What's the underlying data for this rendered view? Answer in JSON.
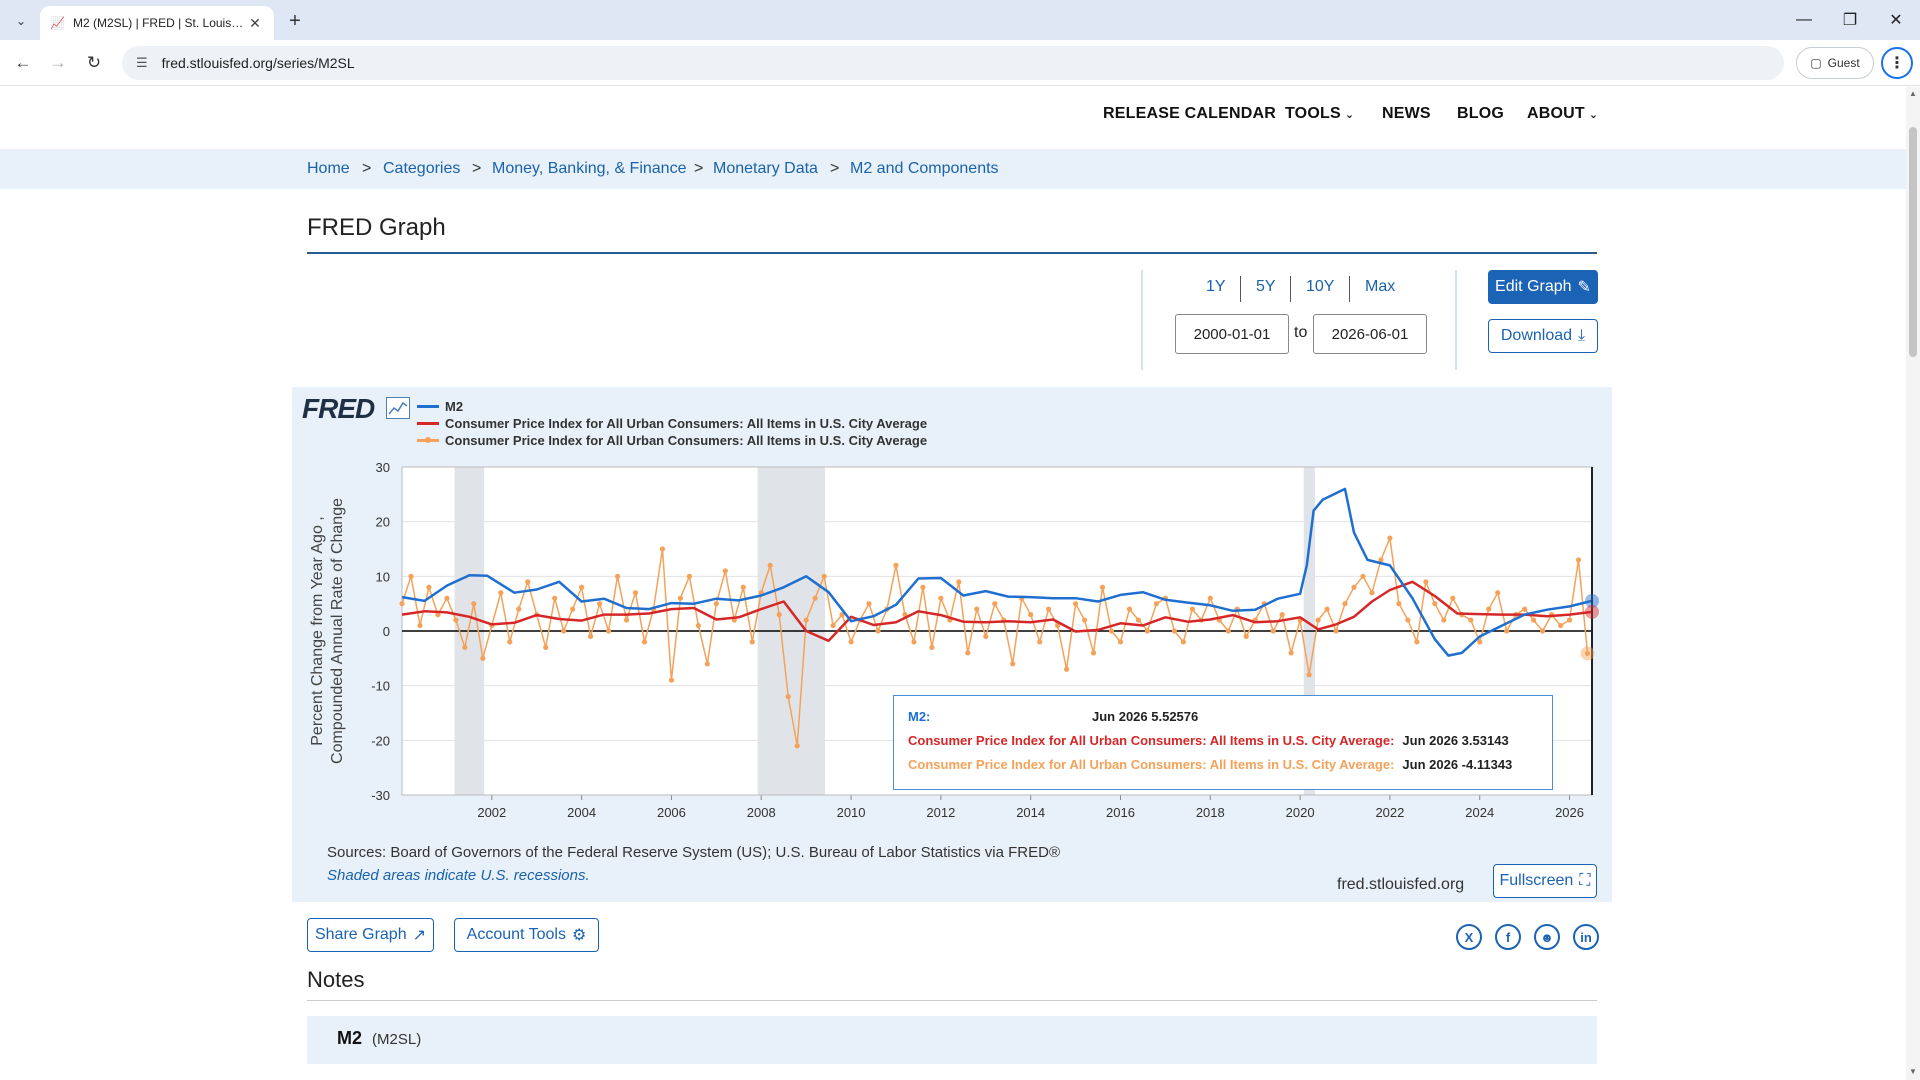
{
  "browser": {
    "tab_title": "M2 (M2SL) | FRED | St. Louis Fed",
    "url": "fred.stlouisfed.org/series/M2SL",
    "profile_label": "Guest"
  },
  "topnav": {
    "release_calendar": "RELEASE CALENDAR",
    "tools": "TOOLS",
    "news": "NEWS",
    "blog": "BLOG",
    "about": "ABOUT"
  },
  "breadcrumb": [
    "Home",
    "Categories",
    "Money, Banking, & Finance",
    "Monetary Data",
    "M2 and Components"
  ],
  "breadcrumb_sep": ">",
  "page_title": "FRED Graph",
  "range": {
    "buttons": [
      "1Y",
      "5Y",
      "10Y",
      "Max"
    ],
    "start": "2000-01-01",
    "end": "2026-06-01",
    "to_label": "to"
  },
  "actions": {
    "edit_graph": "Edit Graph",
    "download": "Download",
    "fullscreen": "Fullscreen",
    "share_graph": "Share Graph",
    "account_tools": "Account Tools"
  },
  "graph": {
    "logo_text": "FRED",
    "sources": "Sources: Board of Governors of the Federal Reserve System (US); U.S. Bureau of Labor Statistics via FRED®",
    "recession_note": "Shaded areas indicate U.S. recessions.",
    "site_url": "fred.stlouisfed.org",
    "tooltip": [
      {
        "label": "M2:",
        "value": "Jun 2026 5.52576",
        "color": "#1f6fd1"
      },
      {
        "label": "Consumer Price Index for All Urban Consumers: All Items in U.S. City Average:",
        "value": "Jun 2026 3.53143",
        "color": "#d62728"
      },
      {
        "label": "Consumer Price Index for All Urban Consumers: All Items in U.S. City Average:",
        "value": "Jun 2026 -4.11343",
        "color": "#f4a259"
      }
    ]
  },
  "chart_data": {
    "type": "line",
    "ylabel": "Percent Change from Year Ago , Compounded Annual Rate of Change",
    "xlabel": "",
    "ylim": [
      -30,
      30
    ],
    "yticks": [
      -30,
      -20,
      -10,
      0,
      10,
      20,
      30
    ],
    "xlim": [
      2000.0,
      2026.5
    ],
    "xticks": [
      2002,
      2004,
      2006,
      2008,
      2010,
      2012,
      2014,
      2016,
      2018,
      2020,
      2022,
      2024,
      2026
    ],
    "recessions": [
      [
        2001.17,
        2001.83
      ],
      [
        2007.92,
        2009.42
      ],
      [
        2020.08,
        2020.33
      ]
    ],
    "grid": true,
    "legend_position": "top-left",
    "series": [
      {
        "name": "M2",
        "color": "#1f6fd1",
        "marker": false,
        "x": [
          2000.0,
          2000.5,
          2001.0,
          2001.5,
          2001.9,
          2002.5,
          2003.0,
          2003.5,
          2004.0,
          2004.5,
          2005.0,
          2005.5,
          2006.0,
          2006.5,
          2007.0,
          2007.5,
          2008.0,
          2008.5,
          2009.0,
          2009.5,
          2010.0,
          2010.5,
          2011.0,
          2011.5,
          2012.0,
          2012.5,
          2013.0,
          2013.5,
          2014.0,
          2014.5,
          2015.0,
          2015.5,
          2016.0,
          2016.5,
          2017.0,
          2017.5,
          2018.0,
          2018.5,
          2019.0,
          2019.5,
          2020.0,
          2020.15,
          2020.3,
          2020.5,
          2021.0,
          2021.2,
          2021.5,
          2022.0,
          2022.5,
          2023.0,
          2023.3,
          2023.6,
          2024.0,
          2024.5,
          2025.0,
          2025.5,
          2026.0,
          2026.5
        ],
        "y": [
          6.2,
          5.5,
          8.3,
          10.2,
          10.1,
          7.0,
          7.6,
          9.0,
          5.4,
          5.9,
          4.2,
          4.0,
          5.1,
          5.0,
          5.9,
          5.6,
          6.5,
          8.0,
          10.0,
          7.1,
          1.8,
          2.7,
          4.8,
          9.6,
          9.7,
          6.5,
          7.3,
          6.3,
          6.2,
          6.0,
          6.0,
          5.4,
          6.6,
          7.1,
          5.7,
          5.2,
          4.7,
          3.7,
          3.9,
          5.9,
          6.8,
          12.0,
          22.0,
          24.0,
          26.0,
          18.0,
          13.0,
          12.0,
          6.0,
          -1.5,
          -4.5,
          -4.0,
          -1.0,
          1.0,
          3.0,
          3.9,
          4.5,
          5.5
        ]
      },
      {
        "name": "Consumer Price Index for All Urban Consumers: All Items in U.S. City Average",
        "color": "#d62728",
        "marker": false,
        "x": [
          2000.0,
          2000.5,
          2001.0,
          2001.5,
          2002.0,
          2002.5,
          2003.0,
          2003.5,
          2004.0,
          2004.5,
          2005.0,
          2005.5,
          2006.0,
          2006.5,
          2007.0,
          2007.5,
          2008.0,
          2008.5,
          2009.0,
          2009.5,
          2010.0,
          2010.5,
          2011.0,
          2011.5,
          2012.0,
          2012.5,
          2013.0,
          2013.5,
          2014.0,
          2014.5,
          2015.0,
          2015.5,
          2016.0,
          2016.5,
          2017.0,
          2017.5,
          2018.0,
          2018.5,
          2019.0,
          2019.5,
          2020.0,
          2020.4,
          2020.8,
          2021.2,
          2021.6,
          2022.0,
          2022.5,
          2023.0,
          2023.5,
          2024.0,
          2024.5,
          2025.0,
          2025.5,
          2026.0,
          2026.5
        ],
        "y": [
          3.0,
          3.6,
          3.4,
          2.6,
          1.2,
          1.5,
          2.9,
          2.2,
          1.9,
          3.0,
          3.0,
          3.2,
          4.0,
          4.2,
          2.1,
          2.5,
          4.0,
          5.4,
          0.0,
          -1.8,
          2.6,
          1.1,
          1.6,
          3.6,
          2.9,
          1.7,
          1.6,
          1.8,
          1.6,
          2.1,
          -0.1,
          0.2,
          1.4,
          1.0,
          2.5,
          1.7,
          2.1,
          2.9,
          1.6,
          1.8,
          2.5,
          0.3,
          1.2,
          2.6,
          5.4,
          7.5,
          9.0,
          6.4,
          3.2,
          3.1,
          3.0,
          3.0,
          2.7,
          3.0,
          3.5
        ]
      },
      {
        "name": "Consumer Price Index for All Urban Consumers: All Items in U.S. City Average",
        "color": "#f4a259",
        "marker": true,
        "x": [
          2000.0,
          2000.2,
          2000.4,
          2000.6,
          2000.8,
          2001.0,
          2001.2,
          2001.4,
          2001.6,
          2001.8,
          2002.0,
          2002.2,
          2002.4,
          2002.6,
          2002.8,
          2003.0,
          2003.2,
          2003.4,
          2003.6,
          2003.8,
          2004.0,
          2004.2,
          2004.4,
          2004.6,
          2004.8,
          2005.0,
          2005.2,
          2005.4,
          2005.6,
          2005.8,
          2006.0,
          2006.2,
          2006.4,
          2006.6,
          2006.8,
          2007.0,
          2007.2,
          2007.4,
          2007.6,
          2007.8,
          2008.0,
          2008.2,
          2008.4,
          2008.6,
          2008.8,
          2009.0,
          2009.2,
          2009.4,
          2009.6,
          2009.8,
          2010.0,
          2010.2,
          2010.4,
          2010.6,
          2010.8,
          2011.0,
          2011.2,
          2011.4,
          2011.6,
          2011.8,
          2012.0,
          2012.2,
          2012.4,
          2012.6,
          2012.8,
          2013.0,
          2013.2,
          2013.4,
          2013.6,
          2013.8,
          2014.0,
          2014.2,
          2014.4,
          2014.6,
          2014.8,
          2015.0,
          2015.2,
          2015.4,
          2015.6,
          2015.8,
          2016.0,
          2016.2,
          2016.4,
          2016.6,
          2016.8,
          2017.0,
          2017.2,
          2017.4,
          2017.6,
          2017.8,
          2018.0,
          2018.2,
          2018.4,
          2018.6,
          2018.8,
          2019.0,
          2019.2,
          2019.4,
          2019.6,
          2019.8,
          2020.0,
          2020.2,
          2020.4,
          2020.6,
          2020.8,
          2021.0,
          2021.2,
          2021.4,
          2021.6,
          2021.8,
          2022.0,
          2022.2,
          2022.4,
          2022.6,
          2022.8,
          2023.0,
          2023.2,
          2023.4,
          2023.6,
          2023.8,
          2024.0,
          2024.2,
          2024.4,
          2024.6,
          2024.8,
          2025.0,
          2025.2,
          2025.4,
          2025.6,
          2025.8,
          2026.0,
          2026.2,
          2026.4
        ],
        "y": [
          5.0,
          10.0,
          1.0,
          8.0,
          3.0,
          6.0,
          2.0,
          -3.0,
          5.0,
          -5.0,
          1.0,
          7.0,
          -2.0,
          4.0,
          9.0,
          3.0,
          -3.0,
          6.0,
          0.0,
          4.0,
          8.0,
          -1.0,
          5.0,
          0.0,
          10.0,
          2.0,
          7.0,
          -2.0,
          4.0,
          15.0,
          -9.0,
          6.0,
          10.0,
          1.0,
          -6.0,
          5.0,
          11.0,
          2.0,
          8.0,
          -2.0,
          7.0,
          12.0,
          3.0,
          -12.0,
          -21.0,
          2.0,
          6.0,
          10.0,
          1.0,
          3.0,
          -2.0,
          2.0,
          5.0,
          0.0,
          4.0,
          12.0,
          3.0,
          -2.0,
          8.0,
          -3.0,
          6.0,
          2.0,
          9.0,
          -4.0,
          4.0,
          -1.0,
          5.0,
          2.0,
          -6.0,
          6.0,
          3.0,
          -2.0,
          4.0,
          1.0,
          -7.0,
          5.0,
          2.0,
          -4.0,
          8.0,
          0.0,
          -2.0,
          4.0,
          2.0,
          0.0,
          5.0,
          6.0,
          0.0,
          -2.0,
          4.0,
          2.0,
          6.0,
          2.0,
          0.0,
          4.0,
          -1.0,
          2.0,
          5.0,
          0.0,
          3.0,
          -4.0,
          2.0,
          -8.0,
          2.0,
          4.0,
          0.0,
          5.0,
          8.0,
          10.0,
          7.0,
          13.0,
          17.0,
          5.0,
          2.0,
          -2.0,
          9.0,
          5.0,
          2.0,
          6.0,
          3.0,
          2.0,
          -2.0,
          4.0,
          7.0,
          0.0,
          3.0,
          4.0,
          2.0,
          0.0,
          3.0,
          1.0,
          2.0,
          13.0,
          -4.1
        ]
      }
    ]
  }
}
